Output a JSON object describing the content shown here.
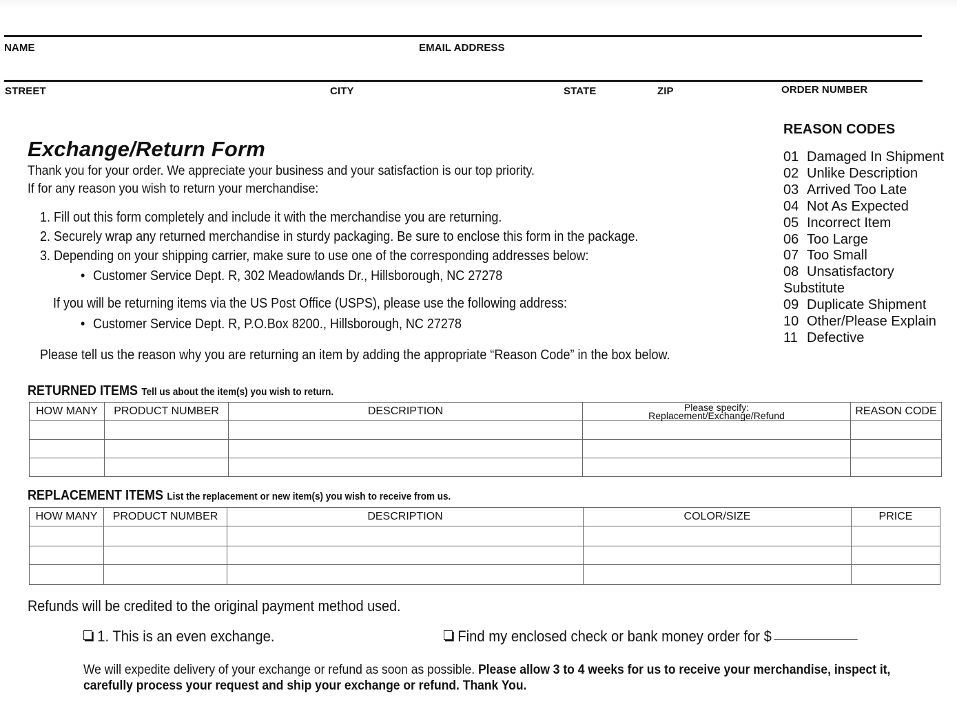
{
  "header_fields": {
    "name": "NAME",
    "email": "EMAIL ADDRESS",
    "street": "STREET",
    "city": "CITY",
    "state": "STATE",
    "zip": "ZIP",
    "order_number": "ORDER NUMBER"
  },
  "form": {
    "title": "Exchange/Return Form",
    "intro_line1": "Thank you for your order. We appreciate your business and your satisfaction is our top priority.",
    "intro_line2": "If for any reason you wish to return your merchandise:",
    "steps": [
      {
        "num": "1.",
        "text": "Fill out this form completely and include it with the merchandise you are returning."
      },
      {
        "num": "2.",
        "text": "Securely wrap any returned merchandise in sturdy packaging. Be sure to enclose this form in the package."
      },
      {
        "num": "3.",
        "text": "Depending on your shipping carrier, make sure to use one of the corresponding addresses below:"
      }
    ],
    "address_carrier": "Customer Service Dept. R, 302 Meadowlands Dr., Hillsborough, NC 27278",
    "usps_note": "If you will be returning items via the US Post Office (USPS), please use the following address:",
    "address_usps": "Customer Service Dept. R, P.O.Box 8200., Hillsborough, NC 27278",
    "reason_instruction": "Please tell us the reason why you are returning an item by adding the appropriate “Reason Code” in the box below."
  },
  "reason_codes": {
    "title": "REASON CODES",
    "items": [
      {
        "code": "01",
        "label": "Damaged In Shipment"
      },
      {
        "code": "02",
        "label": "Unlike Description"
      },
      {
        "code": "03",
        "label": "Arrived Too Late"
      },
      {
        "code": "04",
        "label": "Not As Expected"
      },
      {
        "code": "05",
        "label": "Incorrect Item"
      },
      {
        "code": "06",
        "label": "Too Large"
      },
      {
        "code": "07",
        "label": "Too Small"
      },
      {
        "code": "08",
        "label": "Unsatisfactory Substitute"
      },
      {
        "code": "09",
        "label": "Duplicate Shipment"
      },
      {
        "code": "10",
        "label": "Other/Please Explain"
      },
      {
        "code": "11",
        "label": "Defective"
      }
    ]
  },
  "returned_items": {
    "title": "RETURNED ITEMS",
    "subtitle": "Tell us about the item(s) you wish to return.",
    "columns": [
      "HOW MANY",
      "PRODUCT NUMBER",
      "DESCRIPTION",
      "Please specify:",
      "REASON CODE"
    ],
    "column4_line2": "Replacement/Exchange/Refund",
    "rows": [
      [
        "",
        "",
        "",
        "",
        ""
      ],
      [
        "",
        "",
        "",
        "",
        ""
      ],
      [
        "",
        "",
        "",
        "",
        ""
      ]
    ]
  },
  "replacement_items": {
    "title": "REPLACEMENT ITEMS",
    "subtitle": "List the replacement or new item(s) you wish to receive from us.",
    "columns": [
      "HOW MANY",
      "PRODUCT NUMBER",
      "DESCRIPTION",
      "COLOR/SIZE",
      "PRICE"
    ],
    "rows": [
      [
        "",
        "",
        "",
        "",
        ""
      ],
      [
        "",
        "",
        "",
        "",
        ""
      ],
      [
        "",
        "",
        "",
        "",
        ""
      ]
    ]
  },
  "refund": {
    "note": "Refunds will be credited to the original payment method used.",
    "option_exchange": "1.  This is an even exchange.",
    "option_check": "Find my enclosed check or bank money order for $",
    "check_amount": ""
  },
  "footer": {
    "normal": "We will expedite delivery of your exchange or refund as soon as possible. ",
    "bold": "Please allow 3 to 4 weeks for us to receive your merchandise, inspect it, carefully process your request and ship your exchange or refund. Thank You."
  }
}
